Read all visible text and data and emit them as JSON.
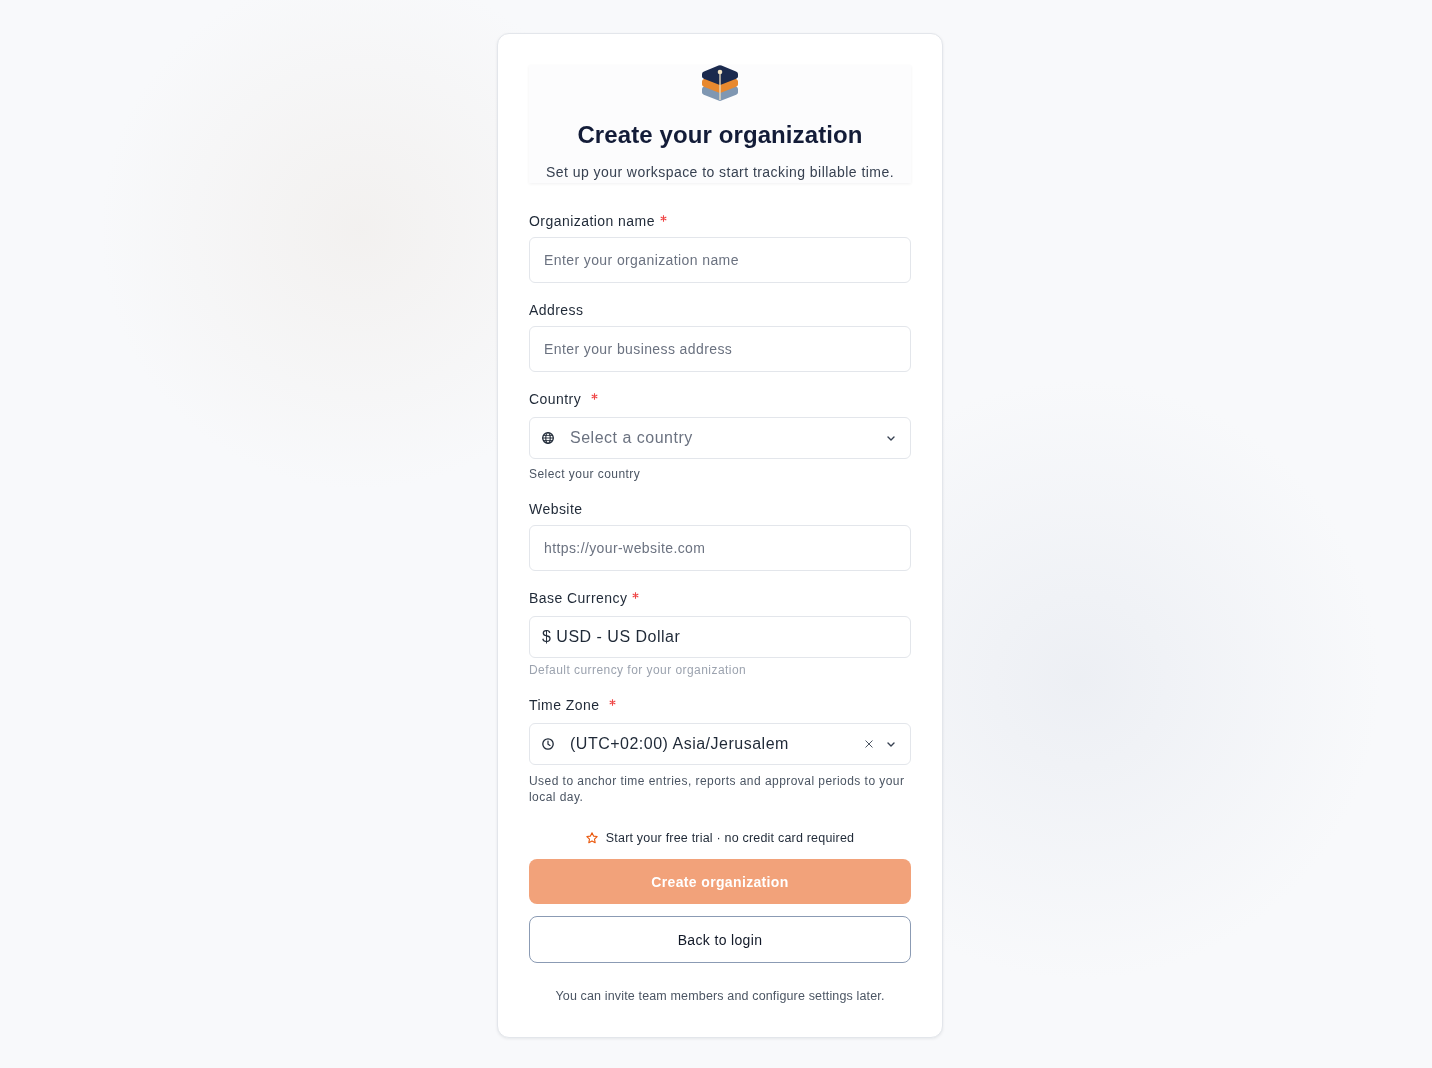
{
  "header": {
    "title": "Create your organization",
    "subtitle": "Set up your workspace to start tracking billable time."
  },
  "fields": [
    {
      "kind": "text",
      "label": "Organization name",
      "required": true,
      "placeholder": "Enter your organization name"
    },
    {
      "kind": "text",
      "label": "Address",
      "required": false,
      "placeholder": "Enter your business address"
    },
    {
      "kind": "country",
      "label": "Country",
      "required": true,
      "placeholder": "Select a country",
      "hint": "Select your country"
    },
    {
      "kind": "text",
      "label": "Website",
      "required": false,
      "placeholder": "https://your-website.com"
    },
    {
      "kind": "currency",
      "label": "Base Currency",
      "required": true,
      "value": "$ USD - US Dollar",
      "hint": "Default currency for your organization"
    },
    {
      "kind": "timezone",
      "label": "Time Zone",
      "required": true,
      "value": "(UTC+02:00) Asia/Jerusalem",
      "hint": "Used to anchor time entries, reports and approval periods to your local day."
    }
  ],
  "trial_note": "Start your free trial · no credit card required",
  "buttons": [
    {
      "kind": "primary",
      "label": "Create organization",
      "disabled": true
    },
    {
      "kind": "secondary",
      "label": "Back to login",
      "disabled": false
    }
  ],
  "footer_note": "You can invite team members and configure settings later."
}
